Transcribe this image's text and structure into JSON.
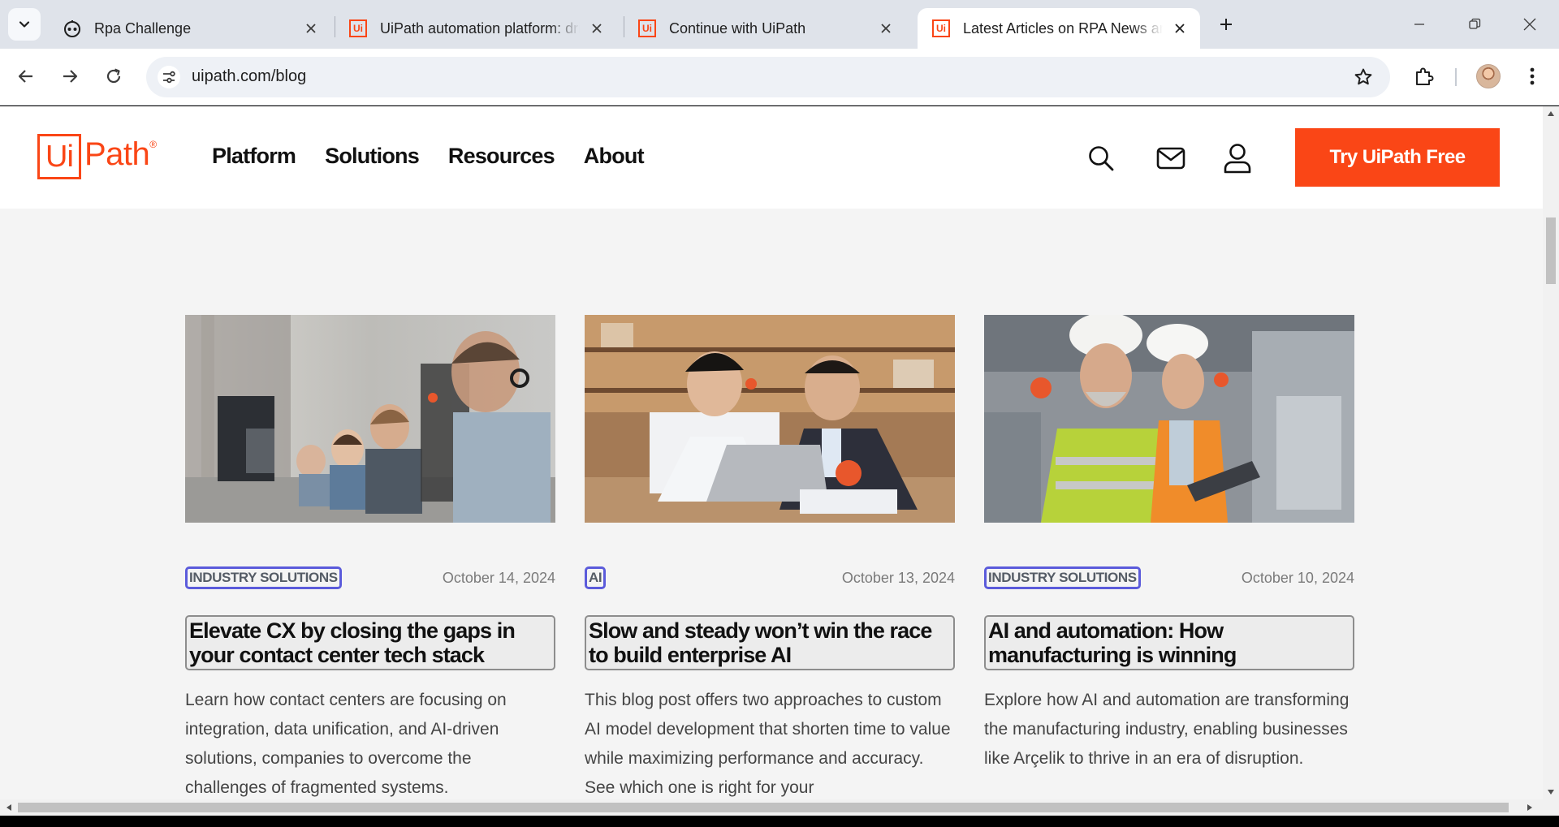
{
  "browser": {
    "tabs": [
      {
        "title": "Rpa Challenge",
        "icon": "robot-icon",
        "active": false
      },
      {
        "title": "UiPath automation platform: dri",
        "icon": "uipath-favicon",
        "active": false
      },
      {
        "title": "Continue with UiPath",
        "icon": "uipath-favicon",
        "active": false
      },
      {
        "title": "Latest Articles on RPA News and",
        "icon": "uipath-favicon",
        "active": true
      }
    ],
    "favicon_letters": "Ui",
    "url": "uipath.com/blog"
  },
  "site": {
    "logo_box": "Ui",
    "logo_text": "Path",
    "logo_reg": "®",
    "nav": [
      "Platform",
      "Solutions",
      "Resources",
      "About"
    ],
    "cta_label": "Try UiPath Free",
    "brand_color": "#fa4616"
  },
  "articles": [
    {
      "category": "INDUSTRY SOLUTIONS",
      "date": "October 14, 2024",
      "title": "Elevate CX by closing the gaps in your contact center tech stack",
      "excerpt": "Learn how contact centers are focusing on integration, data unification, and AI-driven solutions, companies to overcome the challenges of fragmented systems."
    },
    {
      "category": "AI",
      "date": "October 13, 2024",
      "title": "Slow and steady won’t win the race to build enterprise AI",
      "excerpt": "This blog post offers two approaches to custom AI model development that shorten time to value while maximizing performance and accuracy. See which one is right for your"
    },
    {
      "category": "INDUSTRY SOLUTIONS",
      "date": "October 10, 2024",
      "title": "AI and automation: How manufacturing is winning",
      "excerpt": "Explore how AI and automation are transforming the manufacturing industry, enabling businesses like Arçelik to thrive in an era of disruption."
    }
  ],
  "colors": {
    "accent": "#fa4616",
    "category_outline": "#5b5bdb"
  }
}
